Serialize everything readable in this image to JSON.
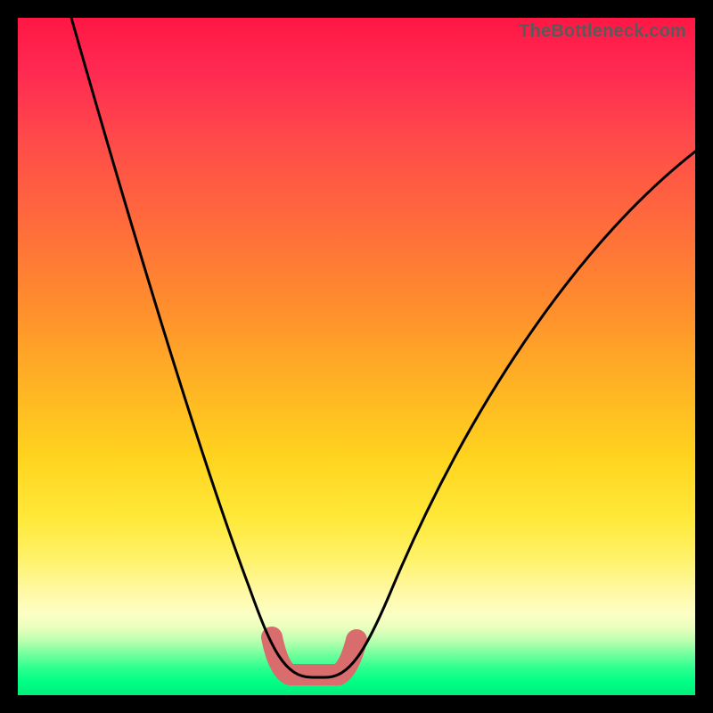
{
  "watermark": "TheBottleneck.com",
  "chart_data": {
    "type": "line",
    "title": "",
    "xlabel": "",
    "ylabel": "",
    "xlim": [
      0,
      100
    ],
    "ylim": [
      0,
      100
    ],
    "grid": false,
    "series": [
      {
        "name": "bottleneck-curve",
        "x": [
          8,
          12,
          16,
          20,
          24,
          28,
          32,
          35,
          38,
          40,
          42,
          44,
          46,
          48,
          52,
          58,
          64,
          70,
          76,
          82,
          88,
          94,
          100
        ],
        "values": [
          100,
          88,
          76,
          64,
          52,
          40,
          28,
          18,
          10,
          5,
          2,
          1,
          1,
          2,
          5,
          12,
          20,
          28,
          35,
          42,
          48,
          54,
          60
        ]
      }
    ],
    "highlight": {
      "name": "bottom-segment",
      "x_range": [
        38,
        48
      ],
      "y": 1,
      "color": "#d96c6c",
      "stroke_width": 18
    },
    "colors": {
      "curve": "#000000",
      "highlight": "#d96c6c",
      "gradient_stops": [
        "#ff1744",
        "#ff8c2e",
        "#ffe93a",
        "#fcffc4",
        "#00ff85"
      ]
    }
  }
}
